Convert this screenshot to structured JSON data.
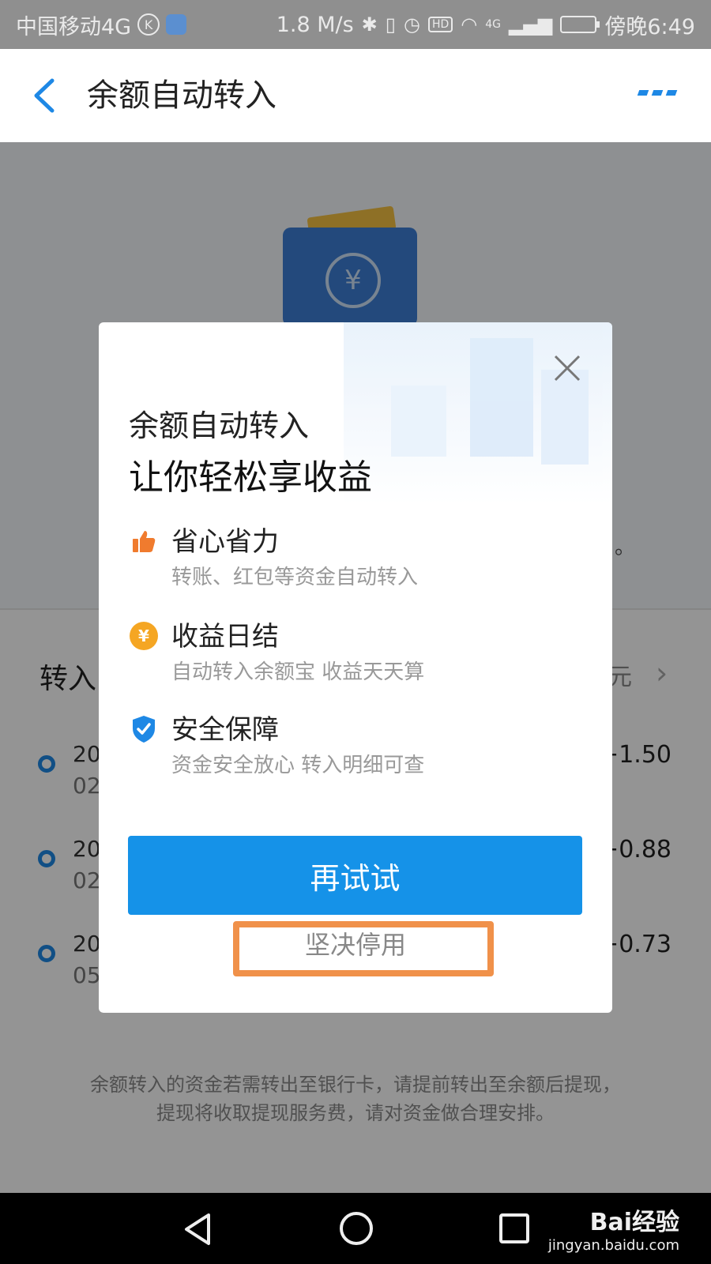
{
  "status_bar": {
    "carrier": "中国移动4G",
    "k_badge": "K",
    "speed": "1.8 M/s",
    "hd": "HD",
    "net": "4G",
    "time": "傍晚6:49"
  },
  "header": {
    "title": "余额自动转入"
  },
  "background_page": {
    "hero_tail": "。",
    "list_title": "转入",
    "list_unit": "元",
    "records": [
      {
        "date_line1": "20",
        "date_line2": "02",
        "amount": "+1.50"
      },
      {
        "date_line1": "20",
        "date_line2": "02",
        "amount": "+0.88"
      },
      {
        "date_line1": "20",
        "date_line2": "05",
        "amount": "+0.73"
      }
    ],
    "footer_note_line1": "余额转入的资金若需转出至银行卡，请提前转出至余额后提现，",
    "footer_note_line2": "提现将收取提现服务费，请对资金做合理安排。"
  },
  "modal": {
    "title_line1": "余额自动转入",
    "title_line2": "让你轻松享收益",
    "features": [
      {
        "icon": "thumbs-up-icon",
        "title": "省心省力",
        "desc": "转账、红包等资金自动转入"
      },
      {
        "icon": "yuan-coin-icon",
        "title": "收益日结",
        "desc": "自动转入余额宝 收益天天算",
        "icon_glyph": "¥"
      },
      {
        "icon": "shield-check-icon",
        "title": "安全保障",
        "desc": "资金安全放心 转入明细可查"
      }
    ],
    "primary_button": "再试试",
    "secondary_button": "坚决停用"
  },
  "watermark": {
    "line1": "Bai经验",
    "line2": "jingyan.baidu.com"
  },
  "colors": {
    "accent": "#1592e8",
    "highlight": "#f0914a",
    "icon_orange": "#f5a623",
    "shield_blue": "#1e88e5"
  }
}
